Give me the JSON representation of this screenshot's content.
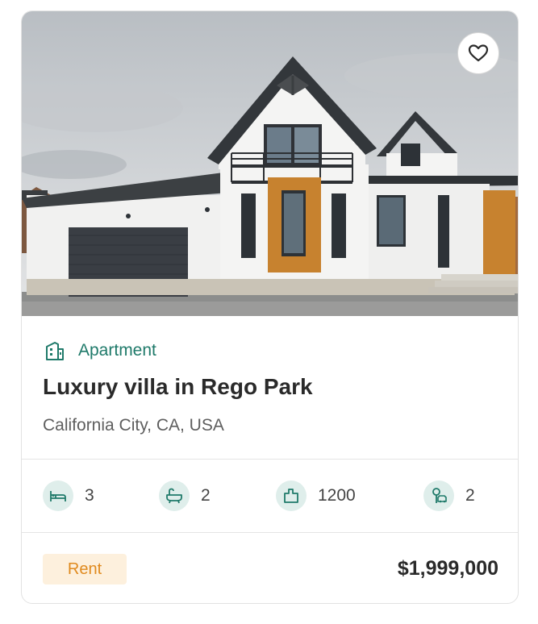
{
  "listing": {
    "favorite_icon": "heart-icon",
    "type_icon": "building-icon",
    "type_label": "Apartment",
    "title": "Luxury villa in Rego Park",
    "address": "California City, CA, USA",
    "features": [
      {
        "icon": "bed-icon",
        "value": "3"
      },
      {
        "icon": "bathtub-icon",
        "value": "2"
      },
      {
        "icon": "area-icon",
        "value": "1200"
      },
      {
        "icon": "garage-icon",
        "value": "2"
      }
    ],
    "badge": "Rent",
    "price": "$1,999,000"
  },
  "colors": {
    "accent": "#1f7a6a",
    "feature_icon_bg": "#dfeeeb",
    "badge_bg": "#fdf0dd",
    "badge_text": "#e08a1e"
  }
}
